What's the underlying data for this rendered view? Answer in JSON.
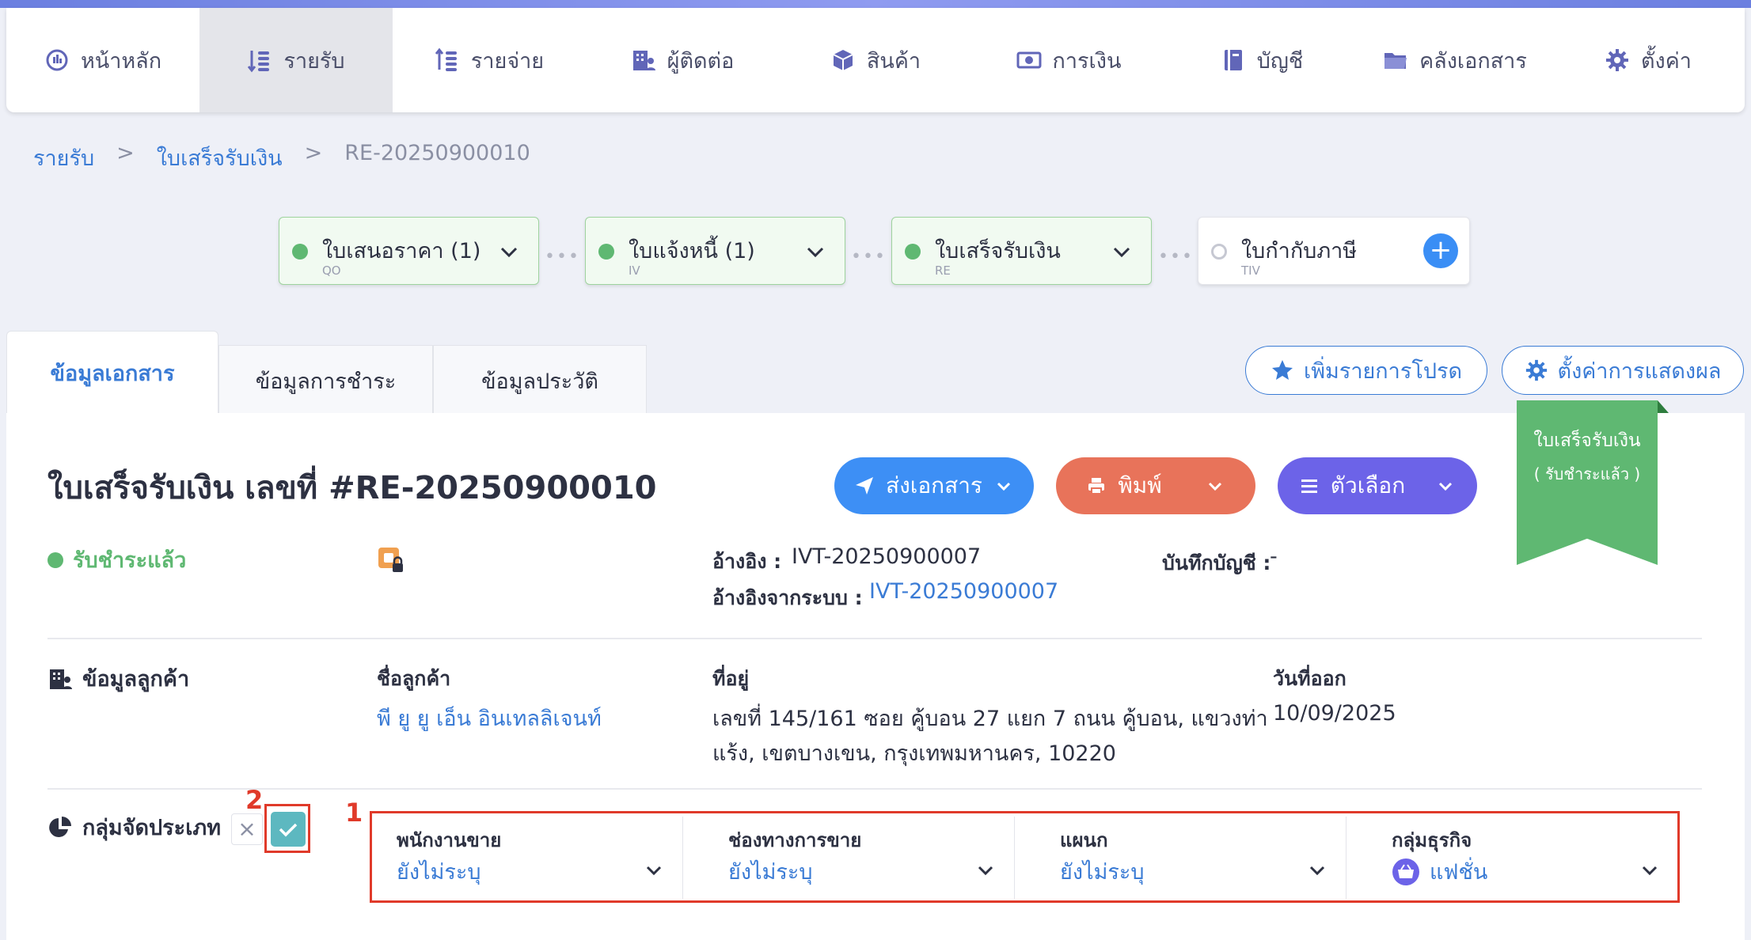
{
  "nav": {
    "items": [
      {
        "label": "หน้าหลัก",
        "icon": "dashboard-icon"
      },
      {
        "label": "รายรับ",
        "icon": "income-icon"
      },
      {
        "label": "รายจ่าย",
        "icon": "expense-icon"
      },
      {
        "label": "ผู้ติดต่อ",
        "icon": "contacts-icon"
      },
      {
        "label": "สินค้า",
        "icon": "box-icon"
      },
      {
        "label": "การเงิน",
        "icon": "money-icon"
      },
      {
        "label": "บัญชี",
        "icon": "ledger-icon"
      },
      {
        "label": "คลังเอกสาร",
        "icon": "folder-icon"
      },
      {
        "label": "ตั้งค่า",
        "icon": "gear-icon"
      }
    ],
    "active_index": 1
  },
  "breadcrumb": {
    "items": [
      "รายรับ",
      "ใบเสร็จรับเงิน",
      "RE-20250900010"
    ],
    "separator": ">"
  },
  "flow": [
    {
      "title": "ใบเสนอราคา (1)",
      "code": "QO",
      "state": "done"
    },
    {
      "title": "ใบแจ้งหนี้ (1)",
      "code": "IV",
      "state": "done"
    },
    {
      "title": "ใบเสร็จรับเงิน",
      "code": "RE",
      "state": "done"
    },
    {
      "title": "ใบกำกับภาษี",
      "code": "TIV",
      "state": "todo",
      "add": "+"
    }
  ],
  "tabs": [
    "ข้อมูลเอกสาร",
    "ข้อมูลการชำระ",
    "ข้อมูลประวัติ"
  ],
  "top_buttons": {
    "favorite": "เพิ่มรายการโปรด",
    "display_settings": "ตั้งค่าการแสดงผล"
  },
  "ribbon": {
    "line1": "ใบเสร็จรับเงิน",
    "line2": "( รับชำระแล้ว )"
  },
  "document": {
    "title": "ใบเสร็จรับเงิน เลขที่ #RE-20250900010",
    "status": "รับชำระแล้ว",
    "actions": {
      "send": "ส่งเอกสาร",
      "print": "พิมพ์",
      "options": "ตัวเลือก"
    },
    "reference_label": "อ้างอิง :",
    "reference_value": "IVT-20250900007",
    "system_ref_label": "อ้างอิงจากระบบ :",
    "system_ref_value": "IVT-20250900007",
    "accounting_label": "บันทึกบัญชี :",
    "accounting_value": "-"
  },
  "customer": {
    "section_title": "ข้อมูลลูกค้า",
    "name_label": "ชื่อลูกค้า",
    "name_value": "พี ยู ยู เอ็น อินเทลลิเจนท์",
    "address_label": "ที่อยู่",
    "address_line1": "เลขที่ 145/161 ซอย คู้บอน 27 แยก 7 ถนน คู้บอน, แขวงท่า",
    "address_line2": "แร้ง, เขตบางเขน, กรุงเทพมหานคร, 10220",
    "date_label": "วันที่ออก",
    "date_value": "10/09/2025"
  },
  "classification": {
    "section_title": "กลุ่มจัดประเภท",
    "clear_glyph": "×",
    "marker_1": "1",
    "marker_2": "2",
    "fields": [
      {
        "label": "พนักงานขาย",
        "value": "ยังไม่ระบุ"
      },
      {
        "label": "ช่องทางการขาย",
        "value": "ยังไม่ระบุ"
      },
      {
        "label": "แผนก",
        "value": "ยังไม่ระบุ"
      },
      {
        "label": "กลุ่มธุรกิจ",
        "value": "แฟชั่น",
        "icon": "basket-icon"
      }
    ]
  },
  "colors": {
    "accent": "#3a7bd5",
    "success": "#5fb872",
    "send_button": "#3d8ff5",
    "print_button": "#e8735a",
    "options_button": "#6c63e8",
    "highlight": "#e03a2a"
  }
}
